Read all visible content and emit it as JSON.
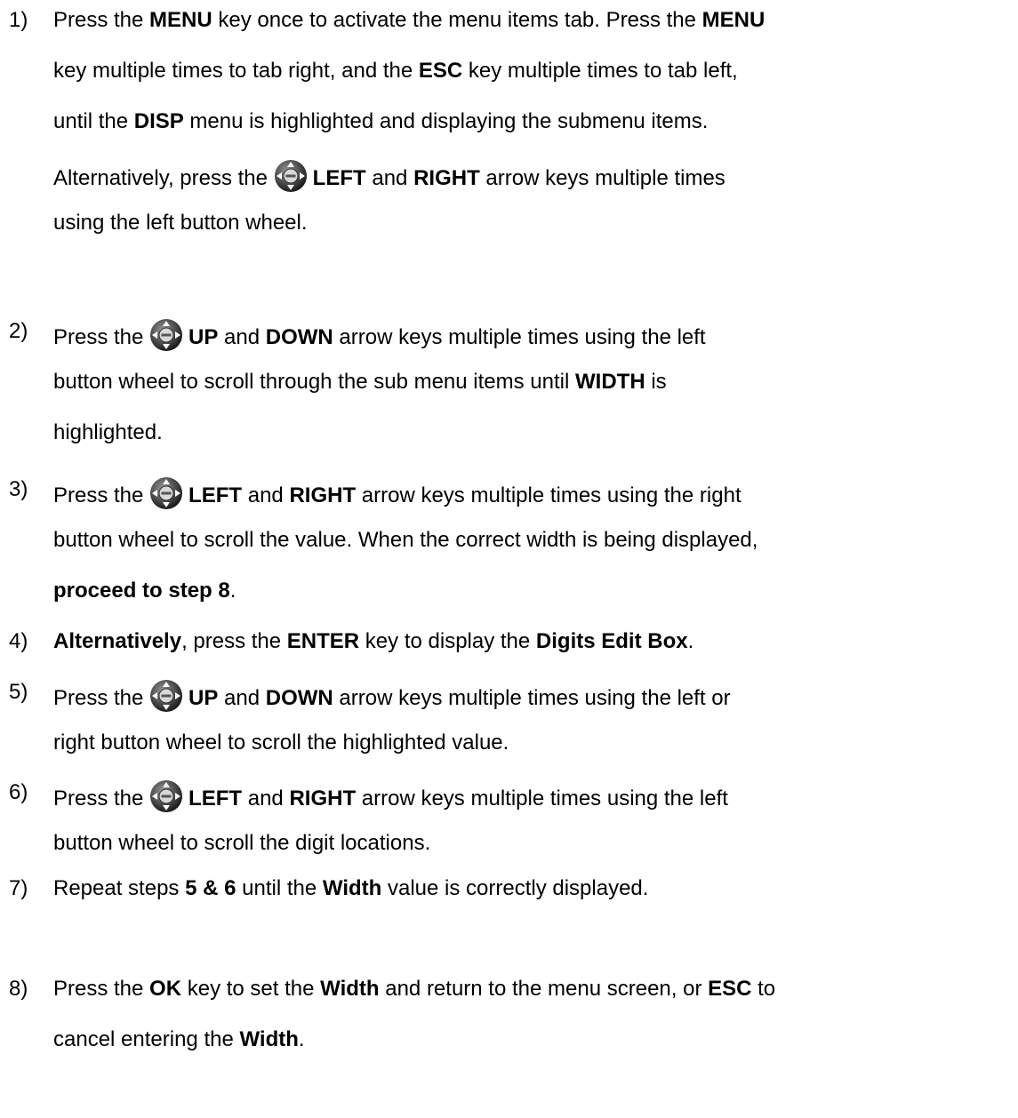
{
  "steps": [
    {
      "number": "1)",
      "lines": [
        [
          {
            "t": "Press the "
          },
          {
            "t": "MENU",
            "b": true
          },
          {
            "t": " key once to activate the menu items tab.  Press the "
          },
          {
            "t": "MENU",
            "b": true
          }
        ],
        [
          {
            "t": "key multiple times to tab right, and the "
          },
          {
            "t": "ESC",
            "b": true
          },
          {
            "t": " key multiple times to tab left,"
          }
        ],
        [
          {
            "t": "until the "
          },
          {
            "t": "DISP",
            "b": true
          },
          {
            "t": " menu is highlighted and displaying the submenu items."
          }
        ],
        [
          {
            "t": "Alternatively, press the  "
          },
          {
            "icon": "nav-wheel-icon"
          },
          {
            "t": "LEFT",
            "b": true
          },
          {
            "t": " and "
          },
          {
            "t": "RIGHT",
            "b": true
          },
          {
            "t": " arrow keys multiple times"
          }
        ],
        [
          {
            "t": "using the left button wheel."
          }
        ]
      ]
    },
    {
      "number": "2)",
      "lines": [
        [
          {
            "t": "Press the "
          },
          {
            "icon": "nav-wheel-icon"
          },
          {
            "t": "UP",
            "b": true
          },
          {
            "t": " and "
          },
          {
            "t": "DOWN",
            "b": true
          },
          {
            "t": " arrow keys multiple times using the left"
          }
        ],
        [
          {
            "t": "button wheel to scroll through the sub menu items until "
          },
          {
            "t": "WIDTH",
            "b": true
          },
          {
            "t": " is"
          }
        ],
        [
          {
            "t": "highlighted."
          }
        ]
      ]
    },
    {
      "number": "3)",
      "lines": [
        [
          {
            "t": "Press the "
          },
          {
            "icon": "nav-wheel-icon"
          },
          {
            "t": "LEFT",
            "b": true
          },
          {
            "t": " and "
          },
          {
            "t": "RIGHT",
            "b": true
          },
          {
            "t": " arrow keys multiple times using the right"
          }
        ],
        [
          {
            "t": "button wheel to scroll the value.  When the correct width is being displayed,"
          }
        ],
        [
          {
            "t": "proceed to step 8",
            "b": true
          },
          {
            "t": "."
          }
        ]
      ]
    },
    {
      "number": "4)",
      "lines": [
        [
          {
            "t": "Alternatively",
            "b": true
          },
          {
            "t": ", press the "
          },
          {
            "t": "ENTER",
            "b": true
          },
          {
            "t": " key to display the "
          },
          {
            "t": "Digits Edit Box",
            "b": true
          },
          {
            "t": "."
          }
        ]
      ]
    },
    {
      "number": "5)",
      "lines": [
        [
          {
            "t": "Press the "
          },
          {
            "icon": "nav-wheel-icon"
          },
          {
            "t": "UP",
            "b": true
          },
          {
            "t": " and "
          },
          {
            "t": "DOWN",
            "b": true
          },
          {
            "t": " arrow keys multiple times using the left or"
          }
        ],
        [
          {
            "t": "right button wheel to scroll the highlighted value."
          }
        ]
      ]
    },
    {
      "number": "6)",
      "lines": [
        [
          {
            "t": "Press the "
          },
          {
            "icon": "nav-wheel-icon"
          },
          {
            "t": "LEFT",
            "b": true
          },
          {
            "t": " and "
          },
          {
            "t": "RIGHT",
            "b": true
          },
          {
            "t": " arrow keys multiple times using the left"
          }
        ],
        [
          {
            "t": "button wheel to scroll the digit locations."
          }
        ]
      ]
    },
    {
      "number": "7)",
      "lines": [
        [
          {
            "t": "Repeat steps "
          },
          {
            "t": "5 & 6",
            "b": true
          },
          {
            "t": " until the "
          },
          {
            "t": "Width",
            "b": true
          },
          {
            "t": " value is correctly displayed."
          }
        ]
      ]
    },
    {
      "number": "8)",
      "lines": [
        [
          {
            "t": "Press the "
          },
          {
            "t": "OK",
            "b": true
          },
          {
            "t": " key to set the "
          },
          {
            "t": "Width",
            "b": true
          },
          {
            "t": " and return to the menu screen, or "
          },
          {
            "t": "ESC",
            "b": true
          },
          {
            "t": " to"
          }
        ],
        [
          {
            "t": "cancel entering the "
          },
          {
            "t": "Width",
            "b": true
          },
          {
            "t": "."
          }
        ]
      ]
    }
  ]
}
